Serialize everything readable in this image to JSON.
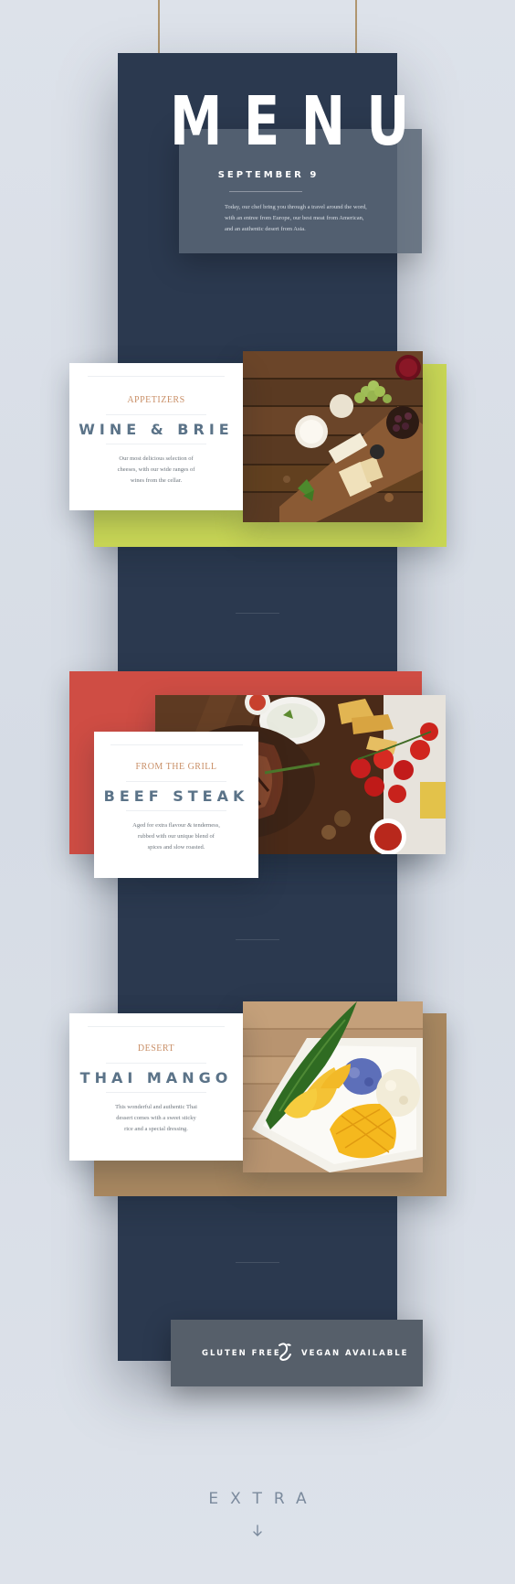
{
  "menu": {
    "title": "MENU",
    "date": "SEPTEMBER 9",
    "intro_lines": [
      "Today, our chef bring you through a travel around the word,",
      "with an entree from Europe, our best meat from American,",
      "and an authentic desert from Asia."
    ]
  },
  "sections": [
    {
      "category": "APPETIZERS",
      "dish": "WINE & BRIE",
      "description_lines": [
        "Our most delicious selection of",
        "cheeses, with our wide ranges of",
        "wines from the cellar."
      ],
      "accent": "#c8d655",
      "photo_icon": "cheese-board-photo"
    },
    {
      "category": "FROM THE GRILL",
      "dish": "BEEF STEAK",
      "description_lines": [
        "Aged for extra flavour & tenderness,",
        "rubbed with our unique blend of",
        "spices and slow roasted."
      ],
      "accent": "#cf4d44",
      "photo_icon": "steak-platter-photo"
    },
    {
      "category": "DESERT",
      "dish": "THAI MANGO",
      "description_lines": [
        "This wonderful and authentic Thai",
        "dessert comes with a sweet sticky",
        "rice and a special dressing."
      ],
      "accent": "#a98860",
      "photo_icon": "mango-sticky-rice-photo"
    }
  ],
  "footer": {
    "left": "GLUTEN FREE",
    "right": "VEGAN AVAILABLE",
    "emblem": "ampersand-leaf-icon"
  },
  "extra": {
    "label": "EXTRA",
    "icon": "arrow-down-icon"
  },
  "colors": {
    "background": "#dde2ea",
    "panel": "#2b394f",
    "category_text": "#c98f67",
    "dish_text": "#5b7388"
  }
}
